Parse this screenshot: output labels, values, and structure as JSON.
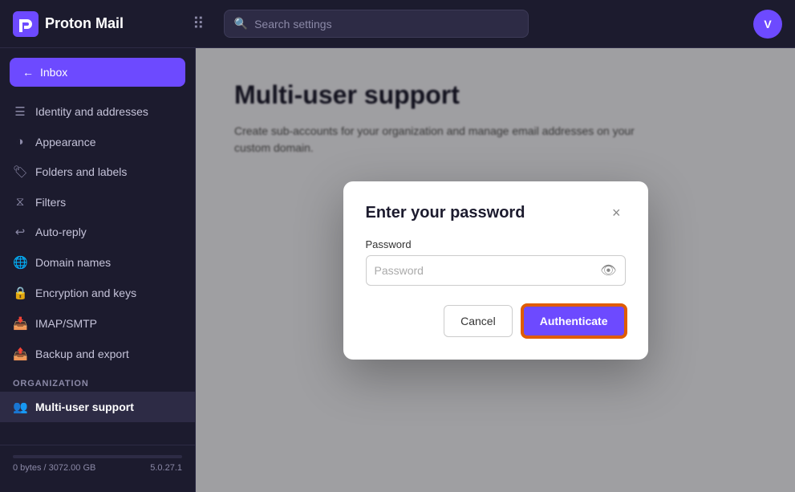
{
  "header": {
    "logo_text": "Proton Mail",
    "search_placeholder": "Search settings",
    "avatar_initials": "V"
  },
  "sidebar": {
    "inbox_label": "Inbox",
    "inbox_arrow": "←",
    "items": [
      {
        "id": "identity-addresses",
        "label": "Identity and addresses",
        "icon": "🪪"
      },
      {
        "id": "appearance",
        "label": "Appearance",
        "icon": "🖌"
      },
      {
        "id": "folders-labels",
        "label": "Folders and labels",
        "icon": "🏷"
      },
      {
        "id": "filters",
        "label": "Filters",
        "icon": "⚗"
      },
      {
        "id": "auto-reply",
        "label": "Auto-reply",
        "icon": "↩"
      },
      {
        "id": "domain-names",
        "label": "Domain names",
        "icon": "🌐"
      },
      {
        "id": "encryption-keys",
        "label": "Encryption and keys",
        "icon": "🔒"
      },
      {
        "id": "imap-smtp",
        "label": "IMAP/SMTP",
        "icon": "📥"
      },
      {
        "id": "backup-export",
        "label": "Backup and export",
        "icon": "📤"
      }
    ],
    "org_label": "ORGANIZATION",
    "org_items": [
      {
        "id": "multi-user-support",
        "label": "Multi-user support",
        "icon": "👥"
      }
    ],
    "storage": {
      "used": "0 bytes",
      "total": "3072.00 GB",
      "version": "5.0.27.1",
      "fill_percent": 0
    }
  },
  "content": {
    "page_title": "Multi-user support",
    "page_subtitle": "Create sub-accounts for your organization and manage email addresses on your custom domain."
  },
  "modal": {
    "title": "Enter your password",
    "close_label": "×",
    "password_label": "Password",
    "password_placeholder": "Password",
    "cancel_label": "Cancel",
    "authenticate_label": "Authenticate"
  }
}
